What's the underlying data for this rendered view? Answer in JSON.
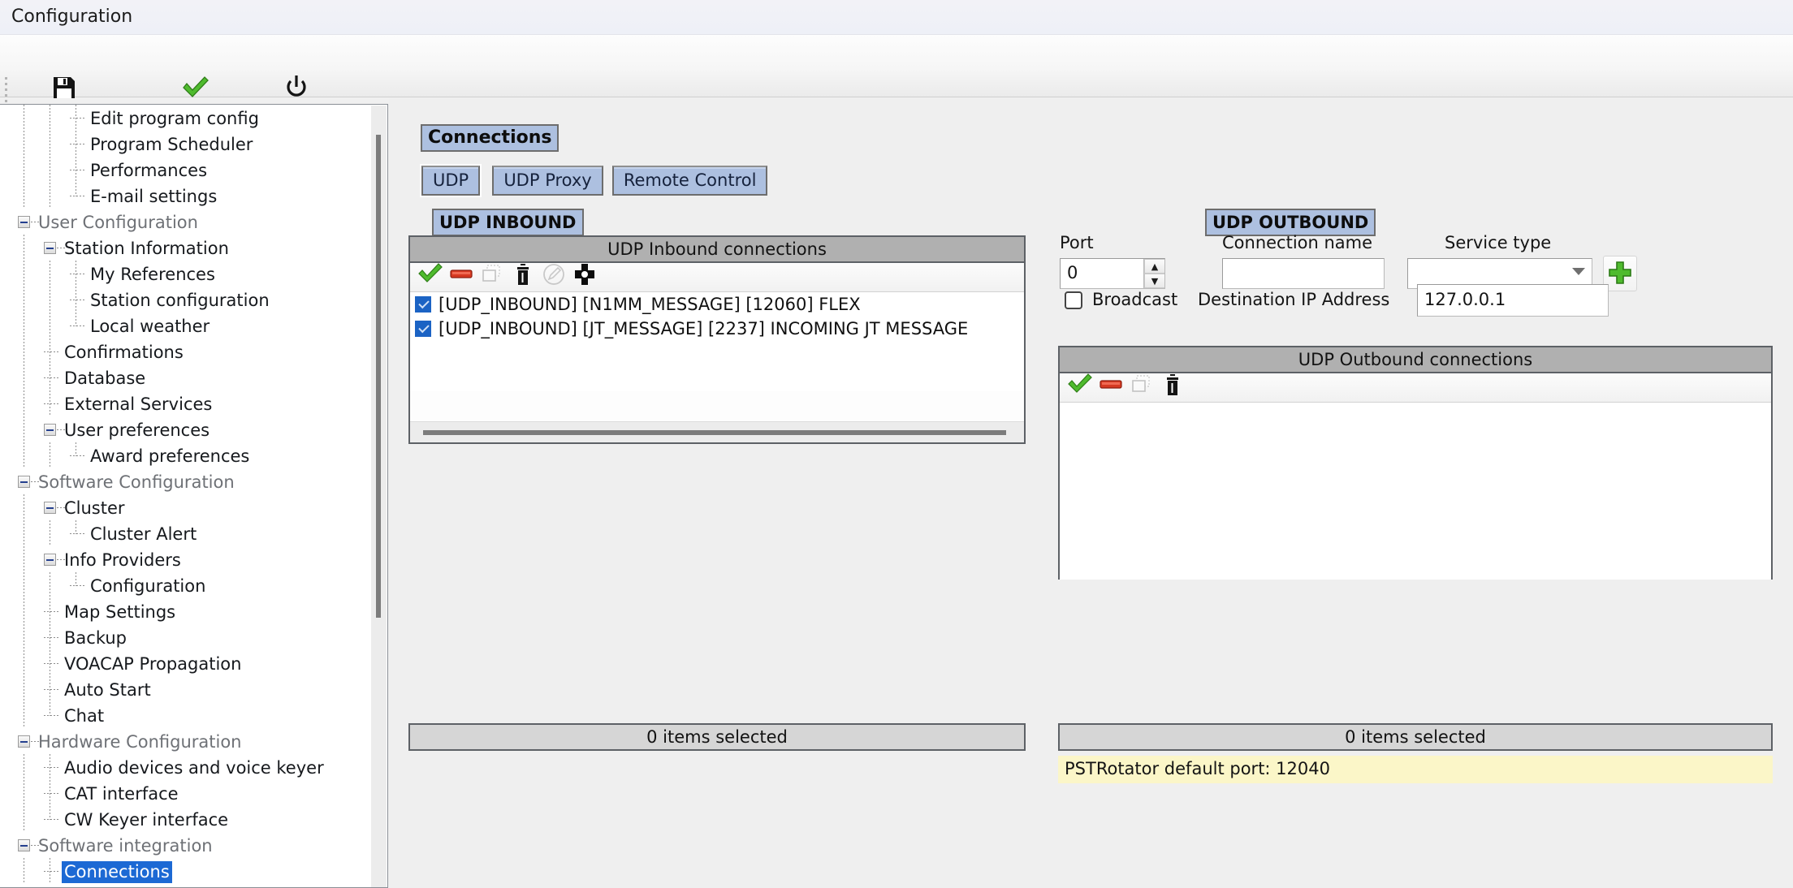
{
  "window": {
    "title": "Configuration"
  },
  "toolbar": {
    "buttons": [
      {
        "label": "Save config",
        "icon": "floppy-disk-icon"
      },
      {
        "label": "Save and apply",
        "icon": "green-check-icon"
      },
      {
        "label": "Exit",
        "icon": "power-icon"
      }
    ]
  },
  "sidebar": {
    "selected": "Connections",
    "items": [
      {
        "label": "Edit program config",
        "depth": 2,
        "expander": false,
        "dim": false
      },
      {
        "label": "Program Scheduler",
        "depth": 2,
        "expander": false,
        "dim": false
      },
      {
        "label": "Performances",
        "depth": 2,
        "expander": false,
        "dim": false
      },
      {
        "label": "E-mail settings",
        "depth": 2,
        "expander": false,
        "dim": false,
        "last": true
      },
      {
        "label": "User Configuration",
        "depth": 0,
        "expander": true,
        "dim": true
      },
      {
        "label": "Station Information",
        "depth": 1,
        "expander": true,
        "dim": false
      },
      {
        "label": "My References",
        "depth": 2,
        "expander": false,
        "dim": false
      },
      {
        "label": "Station configuration",
        "depth": 2,
        "expander": false,
        "dim": false
      },
      {
        "label": "Local weather",
        "depth": 2,
        "expander": false,
        "dim": false,
        "last": true
      },
      {
        "label": "Confirmations",
        "depth": 1,
        "expander": false,
        "dim": false
      },
      {
        "label": "Database",
        "depth": 1,
        "expander": false,
        "dim": false
      },
      {
        "label": "External Services",
        "depth": 1,
        "expander": false,
        "dim": false
      },
      {
        "label": "User preferences",
        "depth": 1,
        "expander": true,
        "dim": false
      },
      {
        "label": "Award preferences",
        "depth": 2,
        "expander": false,
        "dim": false,
        "last": true
      },
      {
        "label": "Software Configuration",
        "depth": 0,
        "expander": true,
        "dim": true
      },
      {
        "label": "Cluster",
        "depth": 1,
        "expander": true,
        "dim": false
      },
      {
        "label": "Cluster Alert",
        "depth": 2,
        "expander": false,
        "dim": false,
        "last": true
      },
      {
        "label": "Info Providers",
        "depth": 1,
        "expander": true,
        "dim": false
      },
      {
        "label": "Configuration",
        "depth": 2,
        "expander": false,
        "dim": false,
        "last": true
      },
      {
        "label": "Map Settings",
        "depth": 1,
        "expander": false,
        "dim": false
      },
      {
        "label": "Backup",
        "depth": 1,
        "expander": false,
        "dim": false
      },
      {
        "label": "VOACAP Propagation",
        "depth": 1,
        "expander": false,
        "dim": false
      },
      {
        "label": "Auto Start",
        "depth": 1,
        "expander": false,
        "dim": false
      },
      {
        "label": "Chat",
        "depth": 1,
        "expander": false,
        "dim": false,
        "last": true
      },
      {
        "label": "Hardware Configuration",
        "depth": 0,
        "expander": true,
        "dim": true
      },
      {
        "label": "Audio devices and voice keyer",
        "depth": 1,
        "expander": false,
        "dim": false
      },
      {
        "label": "CAT interface",
        "depth": 1,
        "expander": false,
        "dim": false
      },
      {
        "label": "CW Keyer interface",
        "depth": 1,
        "expander": false,
        "dim": false,
        "last": true
      },
      {
        "label": "Software integration",
        "depth": 0,
        "expander": true,
        "dim": true
      },
      {
        "label": "Connections",
        "depth": 1,
        "expander": false,
        "dim": false,
        "selected": true
      }
    ]
  },
  "main": {
    "page_title": "Connections",
    "tabs": [
      {
        "label": "UDP",
        "active": true
      },
      {
        "label": "UDP Proxy",
        "active": false
      },
      {
        "label": "Remote Control",
        "active": false
      }
    ],
    "inbound": {
      "section_label": "UDP INBOUND",
      "list_title": "UDP Inbound connections",
      "tools": [
        {
          "name": "enable-icon",
          "glyph": "check",
          "disabled": false
        },
        {
          "name": "disable-icon",
          "glyph": "minus",
          "disabled": false
        },
        {
          "name": "duplicate-icon",
          "glyph": "copy",
          "disabled": true
        },
        {
          "name": "delete-icon",
          "glyph": "trash",
          "disabled": false
        },
        {
          "name": "edit-icon",
          "glyph": "pencil",
          "disabled": true
        },
        {
          "name": "add-icon",
          "glyph": "plus-dot",
          "disabled": false
        }
      ],
      "rows": [
        {
          "checked": true,
          "text": "[UDP_INBOUND] [N1MM_MESSAGE] [12060] FLEX"
        },
        {
          "checked": true,
          "text": "[UDP_INBOUND] [JT_MESSAGE] [2237] INCOMING JT MESSAGE"
        }
      ],
      "status": "0 items selected"
    },
    "outbound": {
      "section_label": "UDP OUTBOUND",
      "port_label": "Port",
      "port_value": "0",
      "connection_name_label": "Connection name",
      "connection_name_value": "",
      "connection_name_placeholder": "",
      "service_type_label": "Service type",
      "service_type_value": "",
      "add_button_label": "+",
      "broadcast_label": "Broadcast",
      "broadcast_checked": false,
      "destination_ip_label": "Destination IP Address",
      "destination_ip_value": "127.0.0.1",
      "list_title": "UDP Outbound connections",
      "tools": [
        {
          "name": "enable-icon",
          "glyph": "check",
          "disabled": false
        },
        {
          "name": "disable-icon",
          "glyph": "minus",
          "disabled": false
        },
        {
          "name": "duplicate-icon",
          "glyph": "copy",
          "disabled": true
        },
        {
          "name": "delete-icon",
          "glyph": "trash",
          "disabled": false
        }
      ],
      "rows": [],
      "status": "0 items selected",
      "hint": "PSTRotator default port: 12040"
    }
  },
  "colors": {
    "accent_blue": "#1c69d4",
    "capsule_blue": "#adc0e0",
    "hint_yellow": "#fbf6c8",
    "list_header_gray": "#b0b0b0",
    "green": "#3fa72f",
    "red": "#d63a22"
  }
}
